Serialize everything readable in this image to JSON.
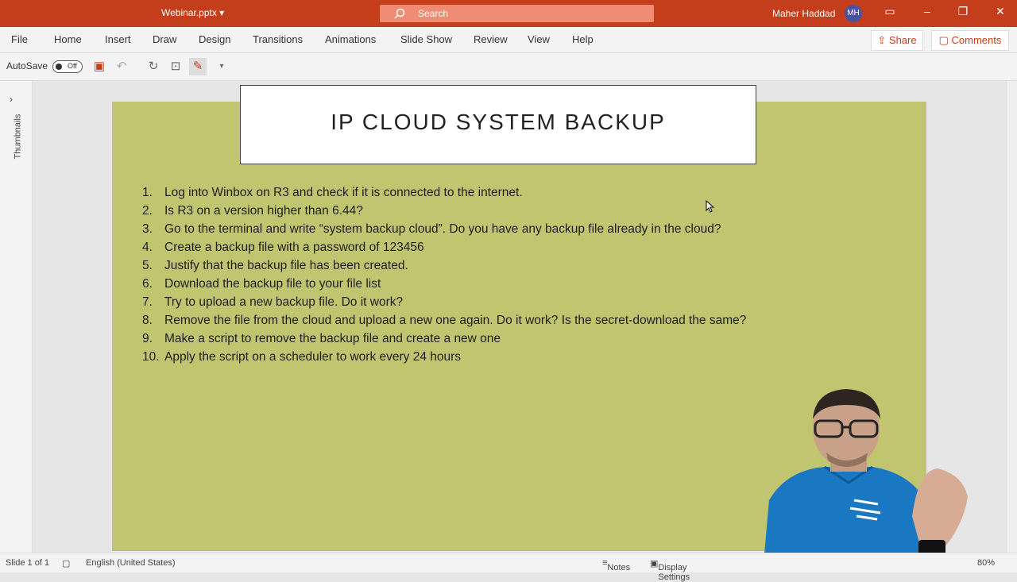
{
  "titlebar": {
    "file_name": "Webinar.pptx",
    "search_placeholder": "Search",
    "user_name": "Maher Haddad",
    "user_initials": "MH",
    "accent": "#c43e1c"
  },
  "menu": {
    "tabs": [
      "File",
      "Home",
      "Insert",
      "Draw",
      "Design",
      "Transitions",
      "Animations",
      "Slide Show",
      "Review",
      "View",
      "Help"
    ],
    "share": "Share",
    "comments": "Comments"
  },
  "qat": {
    "autosave_label": "AutoSave",
    "autosave_state": "Off"
  },
  "side_panel": {
    "label": "Thumbnails"
  },
  "slide": {
    "title": "IP CLOUD SYSTEM BACKUP",
    "background": "#c2c570",
    "items": [
      {
        "num": "1.",
        "text": "Log into Winbox on R3 and check if it is connected to the internet."
      },
      {
        "num": "2.",
        "text": "Is R3 on a version higher than 6.44?"
      },
      {
        "num": "3.",
        "text": "Go to the terminal and write “system backup cloud”. Do you have any backup file already in the cloud?"
      },
      {
        "num": "4.",
        "text": "Create a backup file with a password of 123456"
      },
      {
        "num": "5.",
        "text": "Justify that the backup file has been created."
      },
      {
        "num": "6.",
        "text": "Download the backup file to your file list"
      },
      {
        "num": "7.",
        "text": "Try to upload a new backup file. Do it work?"
      },
      {
        "num": "8.",
        "text": "Remove the file from the cloud and upload a new one again. Do it work? Is the secret-download the same?"
      },
      {
        "num": "9.",
        "text": "Make a script to remove the backup file and create a new one"
      },
      {
        "num": "10.",
        "text": "Apply the script on a scheduler to work every 24 hours"
      }
    ]
  },
  "status": {
    "slide_info": "Slide 1 of 1",
    "language": "English (United States)",
    "notes": "Notes",
    "display": "Display Settings",
    "zoom": "80%"
  }
}
